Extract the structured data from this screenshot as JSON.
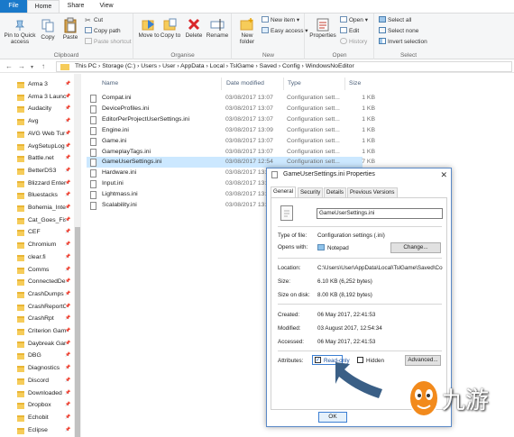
{
  "ribbon": {
    "tabs": [
      "File",
      "Home",
      "Share",
      "View"
    ],
    "clipboard": {
      "pin_label": "Pin to Quick access",
      "copy_label": "Copy",
      "paste_label": "Paste",
      "cut_label": "Cut",
      "copy_path_label": "Copy path",
      "paste_shortcut_label": "Paste shortcut",
      "group_label": "Clipboard"
    },
    "organise": {
      "move_to_label": "Move to",
      "copy_to_label": "Copy to",
      "delete_label": "Delete",
      "rename_label": "Rename",
      "group_label": "Organise"
    },
    "new": {
      "new_folder_label": "New folder",
      "new_item_label": "New item",
      "easy_access_label": "Easy access",
      "group_label": "New"
    },
    "open": {
      "properties_label": "Properties",
      "open_label": "Open",
      "edit_label": "Edit",
      "history_label": "History",
      "group_label": "Open"
    },
    "select": {
      "select_all_label": "Select all",
      "select_none_label": "Select none",
      "invert_label": "Invert selection",
      "group_label": "Select"
    }
  },
  "address": {
    "path": [
      "This PC",
      "Storage (C:)",
      "Users",
      "User",
      "AppData",
      "Local",
      "TslGame",
      "Saved",
      "Config",
      "WindowsNoEditor"
    ]
  },
  "nav_items": [
    "Arma 3",
    "Arma 3 Launc",
    "Audacity",
    "Avg",
    "AVG Web Tur",
    "AvgSetupLog",
    "Battle.net",
    "BetterDS3",
    "Blizzard Enter",
    "Bluestacks",
    "Bohemia_Inte",
    "Cat_Goes_Fisl",
    "CEF",
    "Chromium",
    "clear.fi",
    "Comms",
    "ConnectedDe",
    "CrashDumps",
    "CrashReportC",
    "CrashRpt",
    "Criterion Gam",
    "Daybreak Gar",
    "DBG",
    "Diagnostics",
    "Discord",
    "Downloaded",
    "Dropbox",
    "Echobit",
    "Eclipse"
  ],
  "file_list": {
    "headers": {
      "name": "Name",
      "date": "Date modified",
      "type": "Type",
      "size": "Size"
    },
    "rows": [
      {
        "name": "Compat.ini",
        "date": "03/08/2017 13:07",
        "type": "Configuration sett...",
        "size": "1 KB"
      },
      {
        "name": "DeviceProfiles.ini",
        "date": "03/08/2017 13:07",
        "type": "Configuration sett...",
        "size": "1 KB"
      },
      {
        "name": "EditorPerProjectUserSettings.ini",
        "date": "03/08/2017 13:07",
        "type": "Configuration sett...",
        "size": "1 KB"
      },
      {
        "name": "Engine.ini",
        "date": "03/08/2017 13:09",
        "type": "Configuration sett...",
        "size": "1 KB"
      },
      {
        "name": "Game.ini",
        "date": "03/08/2017 13:07",
        "type": "Configuration sett...",
        "size": "1 KB"
      },
      {
        "name": "GameplayTags.ini",
        "date": "03/08/2017 13:07",
        "type": "Configuration sett...",
        "size": "1 KB"
      },
      {
        "name": "GameUserSettings.ini",
        "date": "03/08/2017 12:54",
        "type": "Configuration sett...",
        "size": "7 KB"
      },
      {
        "name": "Hardware.ini",
        "date": "03/08/2017 13:07",
        "type": "",
        "size": ""
      },
      {
        "name": "Input.ini",
        "date": "03/08/2017 13:07",
        "type": "",
        "size": ""
      },
      {
        "name": "Lightmass.ini",
        "date": "03/08/2017 13:07",
        "type": "",
        "size": ""
      },
      {
        "name": "Scalability.ini",
        "date": "03/08/2017 13:07",
        "type": "",
        "size": ""
      }
    ],
    "selected_index": 6
  },
  "dialog": {
    "title": "GameUserSettings.ini Properties",
    "tabs": [
      "General",
      "Security",
      "Details",
      "Previous Versions"
    ],
    "file_name": "GameUserSettings.ini",
    "type_label": "Type of file:",
    "type_value": "Configuration settings (.ini)",
    "opens_label": "Opens with:",
    "opens_value": "Notepad",
    "change_button": "Change...",
    "location_label": "Location:",
    "location_value": "C:\\Users\\User\\AppData\\Local\\TslGame\\Saved\\Co",
    "size_label": "Size:",
    "size_value": "6.10 KB (6,252 bytes)",
    "size_disk_label": "Size on disk:",
    "size_disk_value": "8.00 KB (8,192 bytes)",
    "created_label": "Created:",
    "created_value": "06 May 2017, 22:41:53",
    "modified_label": "Modified:",
    "modified_value": "03 August 2017, 12:54:34",
    "accessed_label": "Accessed:",
    "accessed_value": "06 May 2017, 22:41:53",
    "attributes_label": "Attributes:",
    "readonly_label": "Read-only",
    "readonly_checked": true,
    "hidden_label": "Hidden",
    "hidden_checked": false,
    "advanced_button": "Advanced...",
    "ok_button": "OK"
  },
  "watermark": {
    "text": "九游"
  },
  "colors": {
    "accent": "#1979ca",
    "selection": "#cce8ff",
    "arrow": "#3a5f86",
    "folder": "#f6cc5a"
  }
}
